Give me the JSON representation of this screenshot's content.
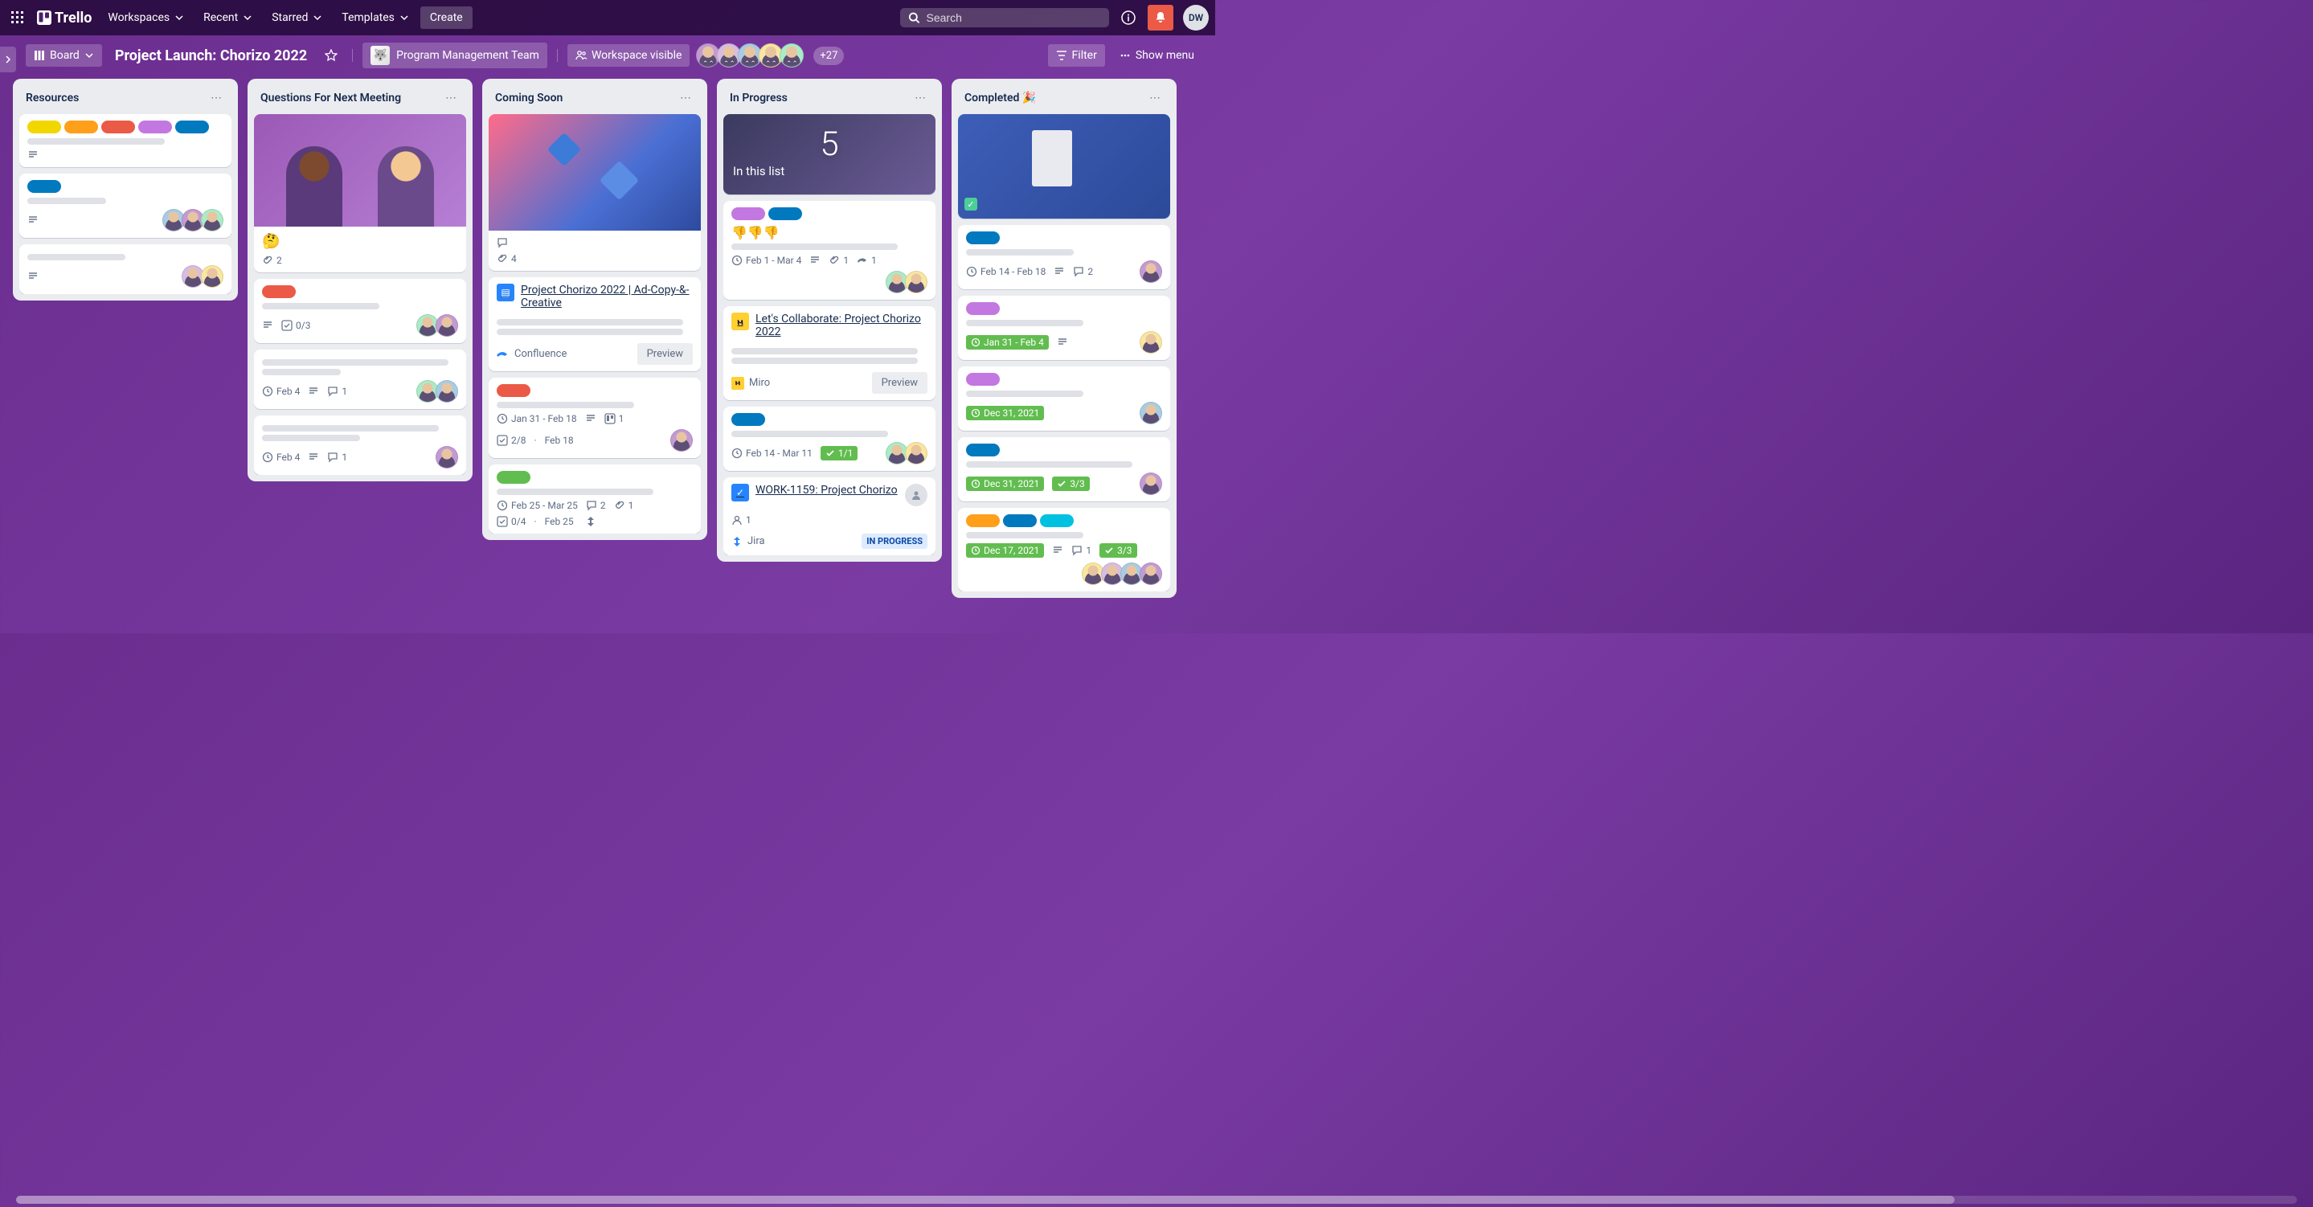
{
  "nav": {
    "logo": "Trello",
    "workspaces": "Workspaces",
    "recent": "Recent",
    "starred": "Starred",
    "templates": "Templates",
    "create": "Create",
    "search_placeholder": "Search",
    "user_initials": "DW"
  },
  "header": {
    "view_label": "Board",
    "title": "Project Launch: Chorizo 2022",
    "team_name": "Program Management Team",
    "visibility": "Workspace visible",
    "extra_members": "+27",
    "filter": "Filter",
    "show_menu": "Show menu"
  },
  "lists": {
    "resources": {
      "title": "Resources"
    },
    "questions": {
      "title": "Questions For Next Meeting",
      "card1_attach": "2",
      "card2_checklist": "0/3",
      "card3_date": "Feb 4",
      "card3_comments": "1",
      "card4_date": "Feb 4",
      "card4_comments": "1"
    },
    "coming": {
      "title": "Coming Soon",
      "card1_attach": "4",
      "card2_title": "Project Chorizo 2022 | Ad-Copy-&-Creative",
      "card2_source": "Confluence",
      "card2_preview": "Preview",
      "card3_date": "Jan 31 - Feb 18",
      "card3_template": "1",
      "card3_checklist": "2/8",
      "card3_due": "Feb 18",
      "card4_date": "Feb 25 - Mar 25",
      "card4_comments": "2",
      "card4_attach": "1",
      "card4_checklist": "0/4",
      "card4_due": "Feb 25"
    },
    "progress": {
      "title": "In Progress",
      "cover_num": "5",
      "cover_text": "In this list",
      "card2_date": "Feb 1 - Mar 4",
      "card2_attach": "1",
      "card2_conf": "1",
      "card3_title": "Let's Collaborate: Project Chorizo 2022",
      "card3_source": "Miro",
      "card3_preview": "Preview",
      "card4_date": "Feb 14 - Mar 11",
      "card4_checklist": "1/1",
      "card5_title": "WORK-1159: Project Chorizo",
      "card5_members": "1",
      "card5_source": "Jira",
      "card5_status": "IN PROGRESS"
    },
    "completed": {
      "title": "Completed 🎉",
      "card2_date": "Feb 14 - Feb 18",
      "card2_comments": "2",
      "card3_date": "Jan 31 - Feb 4",
      "card4_date": "Dec 31, 2021",
      "card5_date": "Dec 31, 2021",
      "card5_checklist": "3/3",
      "card6_date": "Dec 17, 2021",
      "card6_comments": "1",
      "card6_checklist": "3/3"
    }
  }
}
